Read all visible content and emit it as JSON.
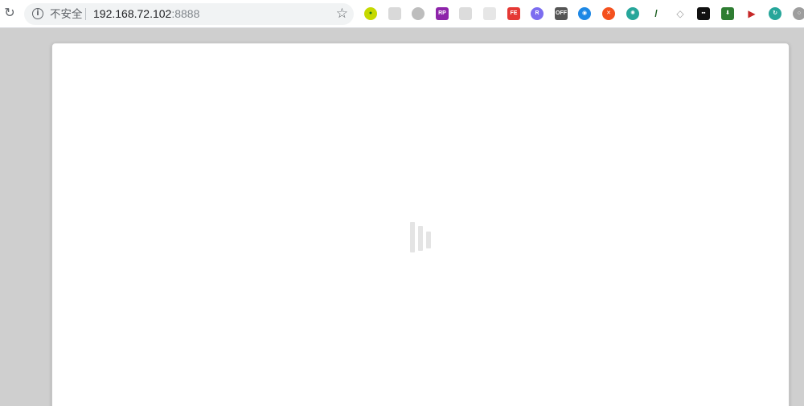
{
  "address_bar": {
    "security_label": "不安全",
    "host": "192.168.72.102",
    "port": ":8888"
  },
  "extensions": [
    {
      "name": "extension-icon-1",
      "color": "#c5d900",
      "glyph": "●",
      "shape": "round",
      "text_color": "#1e7a1e"
    },
    {
      "name": "extension-icon-2",
      "color": "#d9d9d9",
      "glyph": "",
      "shape": "square",
      "text_color": "#ffffff"
    },
    {
      "name": "extension-icon-3",
      "color": "#bdbdbd",
      "glyph": "",
      "shape": "round",
      "text_color": "#ffffff"
    },
    {
      "name": "extension-icon-4",
      "color": "#8e24aa",
      "glyph": "RP",
      "shape": "square",
      "text_color": "#ffffff"
    },
    {
      "name": "extension-icon-5",
      "color": "#dcdcdc",
      "glyph": "",
      "shape": "square",
      "text_color": "#ffffff"
    },
    {
      "name": "extension-icon-6",
      "color": "#e6e6e6",
      "glyph": "",
      "shape": "square",
      "text_color": "#ffffff"
    },
    {
      "name": "extension-icon-7",
      "color": "#e53935",
      "glyph": "FE",
      "shape": "square",
      "text_color": "#ffffff"
    },
    {
      "name": "extension-icon-8",
      "color": "#7c6df0",
      "glyph": "R",
      "shape": "round",
      "text_color": "#ffffff"
    },
    {
      "name": "extension-icon-9",
      "color": "#555555",
      "glyph": "OFF",
      "shape": "square",
      "text_color": "#ffffff"
    },
    {
      "name": "extension-icon-10",
      "color": "#1e88e5",
      "glyph": "◉",
      "shape": "round",
      "text_color": "#ffffff"
    },
    {
      "name": "extension-icon-11",
      "color": "#f4511e",
      "glyph": "✕",
      "shape": "round",
      "text_color": "#ffffff"
    },
    {
      "name": "extension-icon-12",
      "color": "#26a69a",
      "glyph": "✺",
      "shape": "round",
      "text_color": "#ffffff"
    },
    {
      "name": "extension-icon-13",
      "color": "#ffffff",
      "glyph": "/",
      "shape": "square",
      "text_color": "#1b5e20"
    },
    {
      "name": "extension-icon-14",
      "color": "#ffffff",
      "glyph": "◇",
      "shape": "square",
      "text_color": "#9e9e9e"
    },
    {
      "name": "extension-icon-15",
      "color": "#111111",
      "glyph": "▪▪",
      "shape": "square",
      "text_color": "#ffffff"
    },
    {
      "name": "extension-icon-16",
      "color": "#2e7d32",
      "glyph": "⬇",
      "shape": "square",
      "text_color": "#ffffff"
    },
    {
      "name": "extension-icon-17",
      "color": "#ffffff",
      "glyph": "▶",
      "shape": "square",
      "text_color": "#c62828"
    },
    {
      "name": "extension-icon-18",
      "color": "#26a69a",
      "glyph": "↻",
      "shape": "round",
      "text_color": "#ffffff"
    },
    {
      "name": "extension-icon-19",
      "color": "#9e9e9e",
      "glyph": "○",
      "shape": "round",
      "text_color": "#ffffff"
    }
  ],
  "colors": {
    "chrome_background": "#cfcfcf",
    "omnibox_background": "#f1f3f4",
    "card_background": "#ffffff",
    "loader_bar": "#e4e4e4"
  },
  "icons": {
    "reload": "reload-icon",
    "site_info": "info-icon",
    "bookmark": "star-icon",
    "loading": "loading-bars-icon"
  }
}
